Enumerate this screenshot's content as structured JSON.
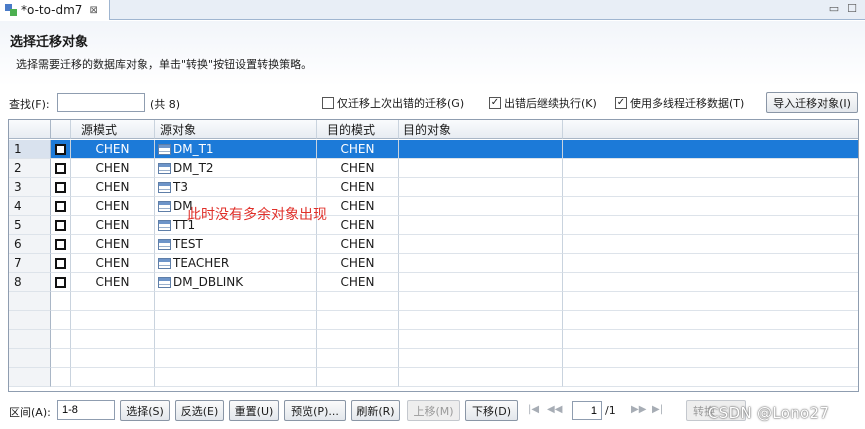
{
  "tab": {
    "title": "*o-to-dm7",
    "close_glyph": "⊠"
  },
  "window_controls": {
    "minimize": "▭",
    "maximize": "☐"
  },
  "header": {
    "title": "选择迁移对象",
    "subtitle": "选择需要迁移的数据库对象，单击\"转换\"按钮设置转换策略。"
  },
  "search": {
    "label": "查找(F):",
    "value": "",
    "count": "(共 8)"
  },
  "options": [
    {
      "label": "仅迁移上次出错的迁移(G)",
      "checked": false
    },
    {
      "label": "出错后继续执行(K)",
      "checked": true
    },
    {
      "label": "使用多线程迁移数据(T)",
      "checked": true
    }
  ],
  "import_button": "导入迁移对象(I)",
  "table": {
    "columns": [
      "",
      "",
      "源模式",
      "源对象",
      "目的模式",
      "目的对象"
    ],
    "rows": [
      {
        "num": "1",
        "src_schema": "CHEN",
        "src_object": "DM_T1",
        "dst_schema": "CHEN",
        "dst_object": "",
        "selected": true
      },
      {
        "num": "2",
        "src_schema": "CHEN",
        "src_object": "DM_T2",
        "dst_schema": "CHEN",
        "dst_object": "",
        "selected": false
      },
      {
        "num": "3",
        "src_schema": "CHEN",
        "src_object": "T3",
        "dst_schema": "CHEN",
        "dst_object": "",
        "selected": false
      },
      {
        "num": "4",
        "src_schema": "CHEN",
        "src_object": "DM",
        "dst_schema": "CHEN",
        "dst_object": "",
        "selected": false
      },
      {
        "num": "5",
        "src_schema": "CHEN",
        "src_object": "TT1",
        "dst_schema": "CHEN",
        "dst_object": "",
        "selected": false
      },
      {
        "num": "6",
        "src_schema": "CHEN",
        "src_object": "TEST",
        "dst_schema": "CHEN",
        "dst_object": "",
        "selected": false
      },
      {
        "num": "7",
        "src_schema": "CHEN",
        "src_object": "TEACHER",
        "dst_schema": "CHEN",
        "dst_object": "",
        "selected": false
      },
      {
        "num": "8",
        "src_schema": "CHEN",
        "src_object": "DM_DBLINK",
        "dst_schema": "CHEN",
        "dst_object": "",
        "selected": false
      }
    ]
  },
  "annotation": "此时没有多余对象出现",
  "bottom": {
    "range_label": "区间(A):",
    "range_value": "1-8",
    "buttons": [
      {
        "label": "选择(S)",
        "enabled": true
      },
      {
        "label": "反选(E)",
        "enabled": true
      },
      {
        "label": "重置(U)",
        "enabled": true
      },
      {
        "label": "预览(P)...",
        "enabled": true
      },
      {
        "label": "刷新(R)",
        "enabled": true
      },
      {
        "label": "上移(M)",
        "enabled": false
      },
      {
        "label": "下移(D)",
        "enabled": true
      }
    ],
    "page_current": "1",
    "page_total": "/1",
    "convert_button": "转换"
  },
  "watermark": "CSDN @Lono27"
}
